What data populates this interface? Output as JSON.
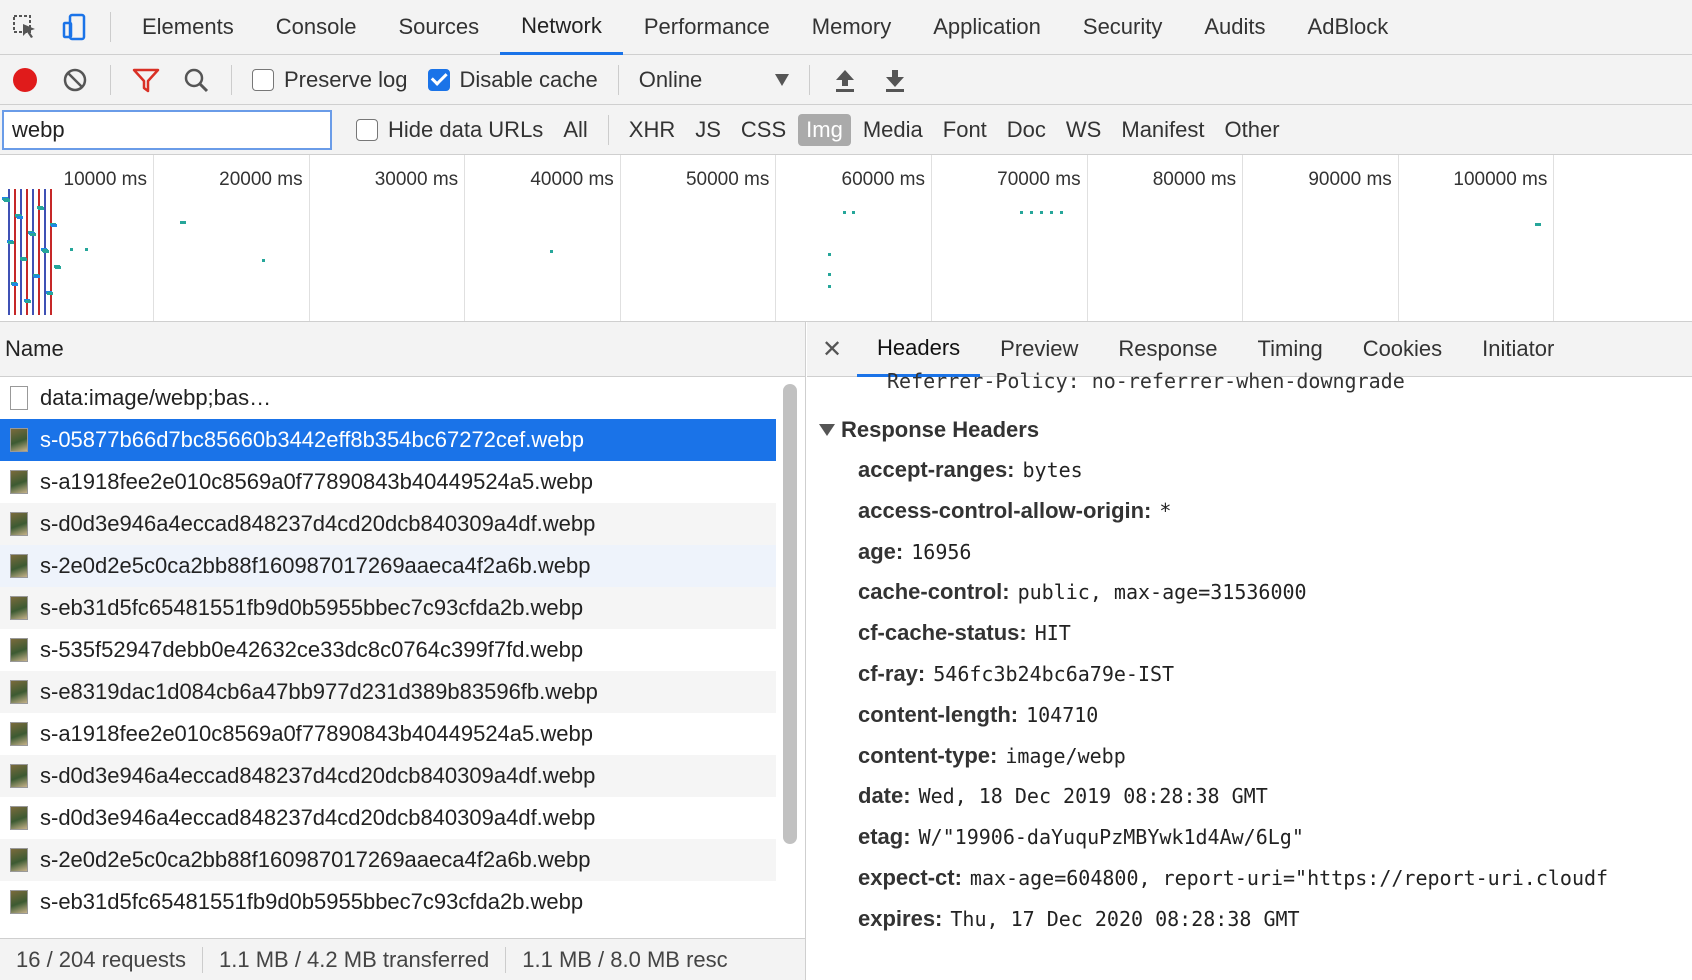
{
  "tabs": [
    "Elements",
    "Console",
    "Sources",
    "Network",
    "Performance",
    "Memory",
    "Application",
    "Security",
    "Audits",
    "AdBlock"
  ],
  "toolbar": {
    "preserve_log": "Preserve log",
    "disable_cache": "Disable cache",
    "throttle": "Online"
  },
  "filter": {
    "value": "webp",
    "hide_data_urls": "Hide data URLs",
    "types": [
      "All",
      "XHR",
      "JS",
      "CSS",
      "Img",
      "Media",
      "Font",
      "Doc",
      "WS",
      "Manifest",
      "Other"
    ]
  },
  "overview": {
    "ticks": [
      "10000 ms",
      "20000 ms",
      "30000 ms",
      "40000 ms",
      "50000 ms",
      "60000 ms",
      "70000 ms",
      "80000 ms",
      "90000 ms",
      "100000 ms"
    ]
  },
  "list": {
    "header": "Name",
    "items": [
      "data:image/webp;bas…",
      "s-05877b66d7bc85660b3442eff8b354bc67272cef.webp",
      "s-a1918fee2e010c8569a0f77890843b40449524a5.webp",
      "s-d0d3e946a4eccad848237d4cd20dcb840309a4df.webp",
      "s-2e0d2e5c0ca2bb88f160987017269aaeca4f2a6b.webp",
      "s-eb31d5fc65481551fb9d0b5955bbec7c93cfda2b.webp",
      "s-535f52947debb0e42632ce33dc8c0764c399f7fd.webp",
      "s-e8319dac1d084cb6a47bb977d231d389b83596fb.webp",
      "s-a1918fee2e010c8569a0f77890843b40449524a5.webp",
      "s-d0d3e946a4eccad848237d4cd20dcb840309a4df.webp",
      "s-d0d3e946a4eccad848237d4cd20dcb840309a4df.webp",
      "s-2e0d2e5c0ca2bb88f160987017269aaeca4f2a6b.webp",
      "s-eb31d5fc65481551fb9d0b5955bbec7c93cfda2b.webp"
    ]
  },
  "status": {
    "requests": "16 / 204 requests",
    "transferred": "1.1 MB / 4.2 MB transferred",
    "resources": "1.1 MB / 8.0 MB resc"
  },
  "detail": {
    "tabs": [
      "Headers",
      "Preview",
      "Response",
      "Timing",
      "Cookies",
      "Initiator"
    ],
    "cutoff_line": "Referrer-Policy: no-referrer-when-downgrade",
    "section": "Response Headers",
    "headers": [
      {
        "k": "accept-ranges:",
        "v": "bytes"
      },
      {
        "k": "access-control-allow-origin:",
        "v": "*"
      },
      {
        "k": "age:",
        "v": "16956"
      },
      {
        "k": "cache-control:",
        "v": "public, max-age=31536000"
      },
      {
        "k": "cf-cache-status:",
        "v": "HIT"
      },
      {
        "k": "cf-ray:",
        "v": "546fc3b24bc6a79e-IST"
      },
      {
        "k": "content-length:",
        "v": "104710"
      },
      {
        "k": "content-type:",
        "v": "image/webp"
      },
      {
        "k": "date:",
        "v": "Wed, 18 Dec 2019 08:28:38 GMT"
      },
      {
        "k": "etag:",
        "v": "W/\"19906-daYuquPzMBYwk1d4Aw/6Lg\""
      },
      {
        "k": "expect-ct:",
        "v": "max-age=604800, report-uri=\"https://report-uri.cloudf"
      },
      {
        "k": "expires:",
        "v": "Thu, 17 Dec 2020 08:28:38 GMT"
      }
    ]
  },
  "colors": {
    "accent": "#1a73e8",
    "record": "#e01b1b",
    "filter_icon": "#d93025"
  }
}
